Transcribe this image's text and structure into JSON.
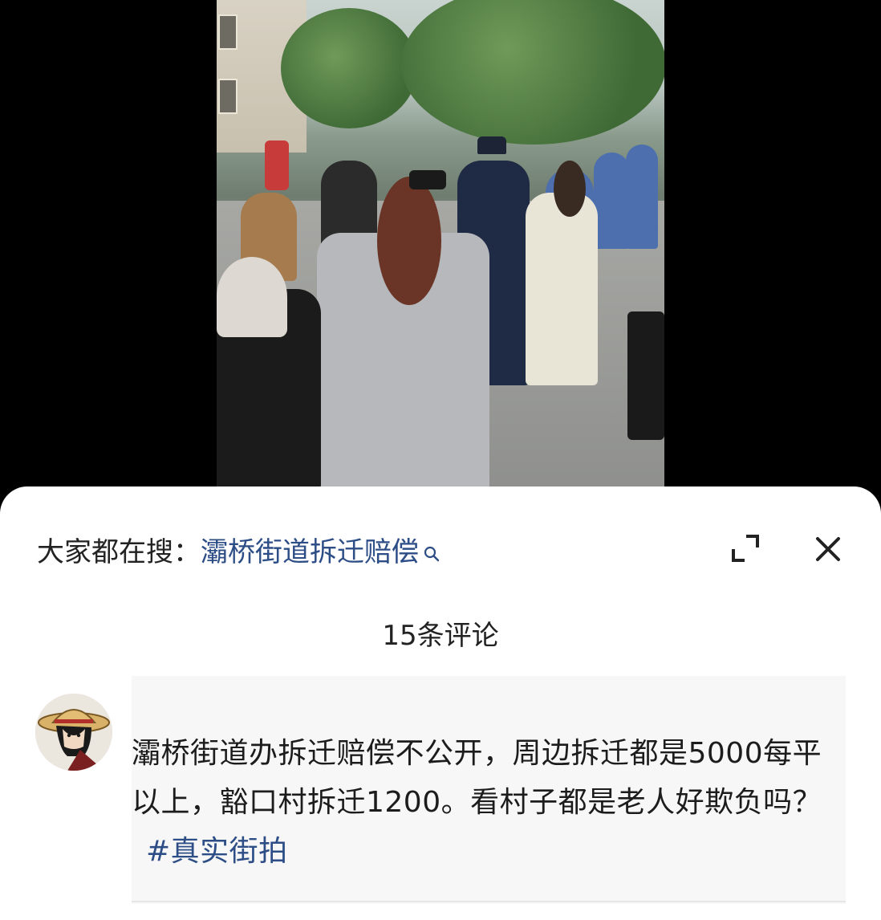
{
  "search": {
    "prefix": "大家都在搜：",
    "term": "灞桥街道拆迁赔偿"
  },
  "header": {
    "comment_count": "15条评论"
  },
  "comment": {
    "text": "灞桥街道办拆迁赔偿不公开，周边拆迁都是5000每平以上，豁口村拆迁1200。看村子都是老人好欺负吗？",
    "hashtag": "#真实街拍"
  },
  "icons": {
    "search": "search-icon",
    "expand": "expand-icon",
    "close": "close-icon"
  },
  "colors": {
    "link": "#2c4d86",
    "text": "#1c1c1c",
    "sheet_bg": "#ffffff",
    "card_bg": "#f7f7f7"
  }
}
